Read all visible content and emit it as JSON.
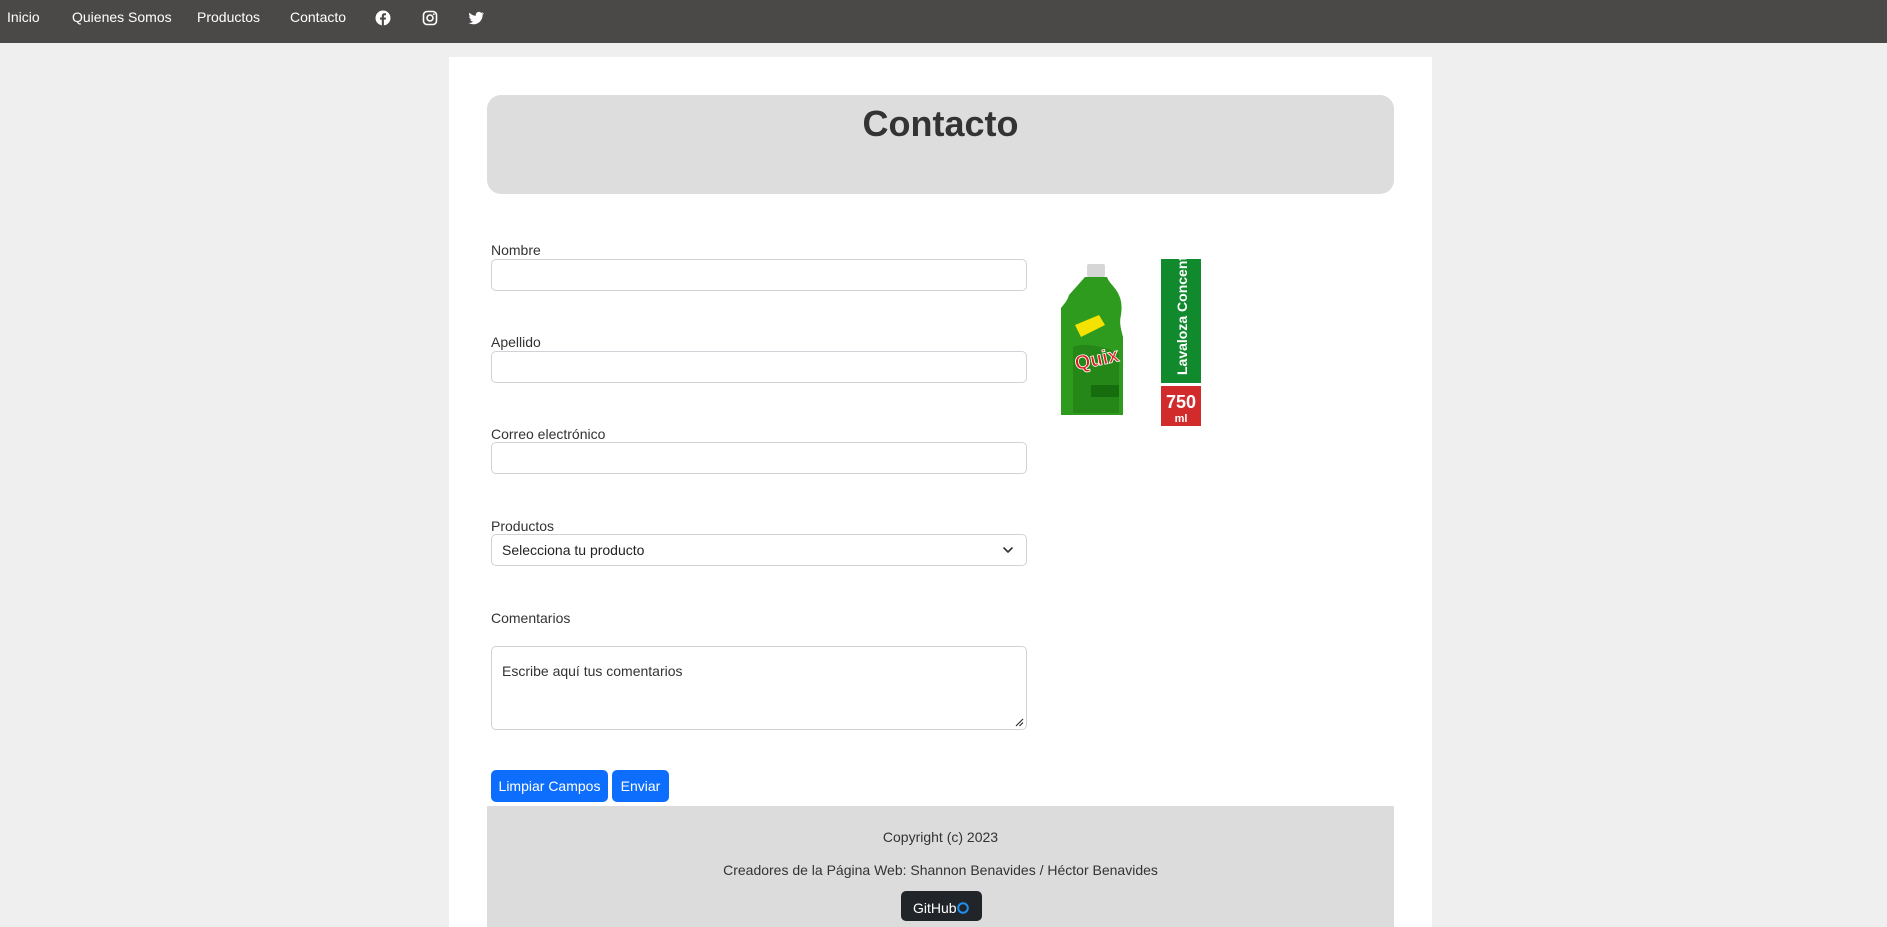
{
  "nav": {
    "links": [
      "Inicio",
      "Quienes Somos",
      "Productos",
      "Contacto"
    ],
    "social_icons": [
      "facebook-icon",
      "instagram-icon",
      "twitter-icon"
    ]
  },
  "page": {
    "title": "Contacto"
  },
  "form": {
    "nombre_label": "Nombre",
    "apellido_label": "Apellido",
    "correo_label": "Correo electrónico",
    "productos_label": "Productos",
    "productos_selected": "Selecciona tu producto",
    "comentarios_label": "Comentarios",
    "comentarios_placeholder": "Escribe aquí tus comentarios",
    "clear_button": "Limpiar Campos",
    "submit_button": "Enviar"
  },
  "product_image": {
    "brand": "Quix",
    "side_text": "Lavaloza Concentrado",
    "volume": "750",
    "unit": "ml"
  },
  "footer": {
    "copyright": "Copyright (c) 2023",
    "creators": "Creadores de la Página Web: Shannon Benavides / Héctor Benavides",
    "github": "GitHub"
  },
  "colors": {
    "navbar": "#4b4848",
    "primary_button": "#0d6efd",
    "header_box": "#dddddd",
    "footer": "#dcdcdc",
    "github_button": "#212529"
  }
}
